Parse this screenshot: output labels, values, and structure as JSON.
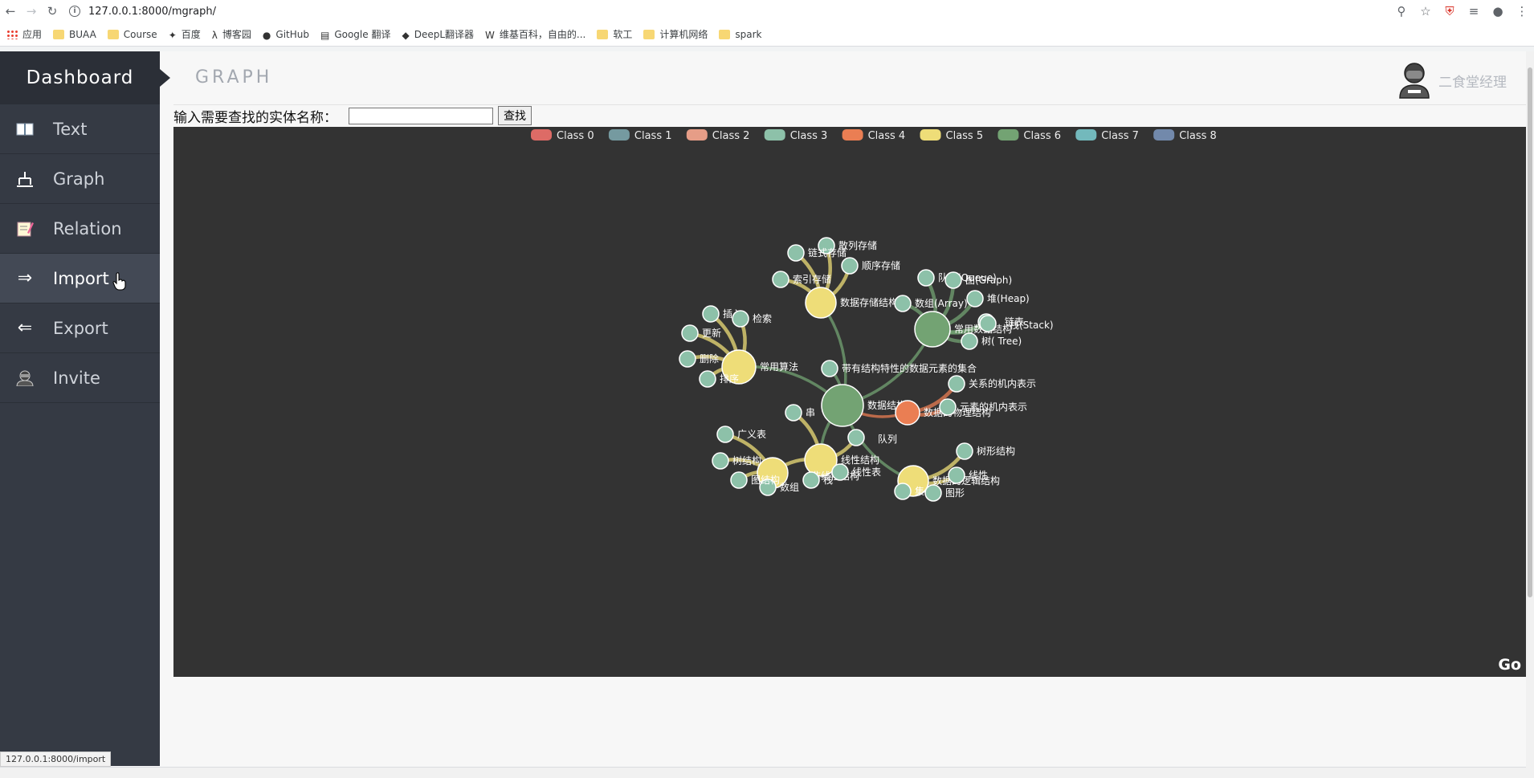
{
  "browser": {
    "url": "127.0.0.1:8000/mgraph/",
    "status_url": "127.0.0.1:8000/import",
    "bookmarks": [
      {
        "label": "应用",
        "icon": "apps-icon"
      },
      {
        "label": "BUAA",
        "icon": "folder-icon"
      },
      {
        "label": "Course",
        "icon": "folder-icon"
      },
      {
        "label": "百度",
        "icon": "baidu-icon"
      },
      {
        "label": "博客园",
        "icon": "cnblogs-icon"
      },
      {
        "label": "GitHub",
        "icon": "github-icon"
      },
      {
        "label": "Google 翻译",
        "icon": "google-translate-icon"
      },
      {
        "label": "DeepL翻译器",
        "icon": "deepl-icon"
      },
      {
        "label": "维基百科，自由的...",
        "icon": "wikipedia-icon"
      },
      {
        "label": "软工",
        "icon": "folder-icon"
      },
      {
        "label": "计算机网络",
        "icon": "folder-icon"
      },
      {
        "label": "spark",
        "icon": "folder-icon"
      }
    ]
  },
  "sidebar": {
    "title": "Dashboard",
    "items": [
      {
        "label": "Text",
        "icon": "book-icon"
      },
      {
        "label": "Graph",
        "icon": "graph-icon"
      },
      {
        "label": "Relation",
        "icon": "notepad-icon"
      },
      {
        "label": "Import",
        "icon": "import-arrow-icon"
      },
      {
        "label": "Export",
        "icon": "export-arrow-icon"
      },
      {
        "label": "Invite",
        "icon": "invite-icon"
      }
    ]
  },
  "header": {
    "title": "GRAPH",
    "user_name": "二食堂经理"
  },
  "search": {
    "label": "输入需要查找的实体名称：",
    "value": "",
    "button": "查找"
  },
  "legend": [
    {
      "name": "Class 0",
      "color": "#dd6b66"
    },
    {
      "name": "Class 1",
      "color": "#759aa0"
    },
    {
      "name": "Class 2",
      "color": "#e69d87"
    },
    {
      "name": "Class 3",
      "color": "#8dc1a9"
    },
    {
      "name": "Class 4",
      "color": "#ea7e53"
    },
    {
      "name": "Class 5",
      "color": "#eedd78"
    },
    {
      "name": "Class 6",
      "color": "#73a373"
    },
    {
      "name": "Class 7",
      "color": "#73b9bc"
    },
    {
      "name": "Class 8",
      "color": "#7289ab"
    }
  ],
  "graph": {
    "go_label": "Go",
    "nodes": [
      {
        "id": "root",
        "label": "数据结构",
        "cls": 6
      },
      {
        "id": "n_set",
        "label": "带有结构特性的数据元素的集合",
        "cls": 3
      },
      {
        "id": "c_storage",
        "label": "数据存储结构",
        "cls": 5
      },
      {
        "id": "c_common",
        "label": "常用数据结构",
        "cls": 6
      },
      {
        "id": "c_algo",
        "label": "常用算法",
        "cls": 5
      },
      {
        "id": "c_phys",
        "label": "数据的物理结构",
        "cls": 4
      },
      {
        "id": "c_logic",
        "label": "数据的逻辑结构",
        "cls": 5
      },
      {
        "id": "c_linear",
        "label": "线性结构",
        "cls": 5
      },
      {
        "id": "c_nonlin",
        "label": "非线性结构",
        "cls": 5
      },
      {
        "id": "s1",
        "label": "散列存储",
        "cls": 3
      },
      {
        "id": "s2",
        "label": "链式存储",
        "cls": 3
      },
      {
        "id": "s3",
        "label": "顺序存储",
        "cls": 3
      },
      {
        "id": "s4",
        "label": "索引存储",
        "cls": 3
      },
      {
        "id": "d1",
        "label": "队列(Queue)",
        "cls": 3
      },
      {
        "id": "d2",
        "label": "图(Graph)",
        "cls": 3
      },
      {
        "id": "d3",
        "label": "堆(Heap)",
        "cls": 3
      },
      {
        "id": "d4",
        "label": "数组(Array)",
        "cls": 3
      },
      {
        "id": "d5",
        "label": "栈(Stack)",
        "cls": 3
      },
      {
        "id": "d6",
        "label": "链表",
        "cls": 3
      },
      {
        "id": "d7",
        "label": "树( Tree)",
        "cls": 3
      },
      {
        "id": "a1",
        "label": "插入",
        "cls": 3
      },
      {
        "id": "a2",
        "label": "检索",
        "cls": 3
      },
      {
        "id": "a3",
        "label": "更新",
        "cls": 3
      },
      {
        "id": "a4",
        "label": "删除",
        "cls": 3
      },
      {
        "id": "a5",
        "label": "排序",
        "cls": 3
      },
      {
        "id": "p1",
        "label": "关系的机内表示",
        "cls": 3
      },
      {
        "id": "p2",
        "label": "元素的机内表示",
        "cls": 3
      },
      {
        "id": "l1",
        "label": "串",
        "cls": 3
      },
      {
        "id": "l2",
        "label": "队列",
        "cls": 3
      },
      {
        "id": "l3",
        "label": "栈",
        "cls": 3
      },
      {
        "id": "l4",
        "label": "线性表",
        "cls": 3
      },
      {
        "id": "l5",
        "label": "数组",
        "cls": 3
      },
      {
        "id": "nl1",
        "label": "广义表",
        "cls": 3
      },
      {
        "id": "nl2",
        "label": "树结构",
        "cls": 3
      },
      {
        "id": "nl3",
        "label": "图结构",
        "cls": 3
      },
      {
        "id": "g1",
        "label": "树形结构",
        "cls": 3
      },
      {
        "id": "g2",
        "label": "线性",
        "cls": 3
      },
      {
        "id": "g3",
        "label": "集合",
        "cls": 3
      },
      {
        "id": "g4",
        "label": "图形",
        "cls": 3
      }
    ],
    "links": [
      [
        "root",
        "n_set"
      ],
      [
        "root",
        "c_storage"
      ],
      [
        "root",
        "c_common"
      ],
      [
        "root",
        "c_algo"
      ],
      [
        "root",
        "c_phys"
      ],
      [
        "root",
        "c_logic"
      ],
      [
        "root",
        "c_linear"
      ],
      [
        "c_storage",
        "s1"
      ],
      [
        "c_storage",
        "s2"
      ],
      [
        "c_storage",
        "s3"
      ],
      [
        "c_storage",
        "s4"
      ],
      [
        "c_common",
        "d1"
      ],
      [
        "c_common",
        "d2"
      ],
      [
        "c_common",
        "d3"
      ],
      [
        "c_common",
        "d4"
      ],
      [
        "c_common",
        "d5"
      ],
      [
        "c_common",
        "d6"
      ],
      [
        "c_common",
        "d7"
      ],
      [
        "c_algo",
        "a1"
      ],
      [
        "c_algo",
        "a2"
      ],
      [
        "c_algo",
        "a3"
      ],
      [
        "c_algo",
        "a4"
      ],
      [
        "c_algo",
        "a5"
      ],
      [
        "c_phys",
        "p1"
      ],
      [
        "c_phys",
        "p2"
      ],
      [
        "c_linear",
        "l1"
      ],
      [
        "c_linear",
        "l2"
      ],
      [
        "c_linear",
        "l3"
      ],
      [
        "c_linear",
        "l4"
      ],
      [
        "c_linear",
        "c_nonlin"
      ],
      [
        "c_nonlin",
        "nl1"
      ],
      [
        "c_nonlin",
        "nl2"
      ],
      [
        "c_nonlin",
        "nl3"
      ],
      [
        "c_nonlin",
        "l5"
      ],
      [
        "c_logic",
        "g1"
      ],
      [
        "c_logic",
        "g2"
      ],
      [
        "c_logic",
        "g3"
      ],
      [
        "c_logic",
        "g4"
      ]
    ]
  }
}
